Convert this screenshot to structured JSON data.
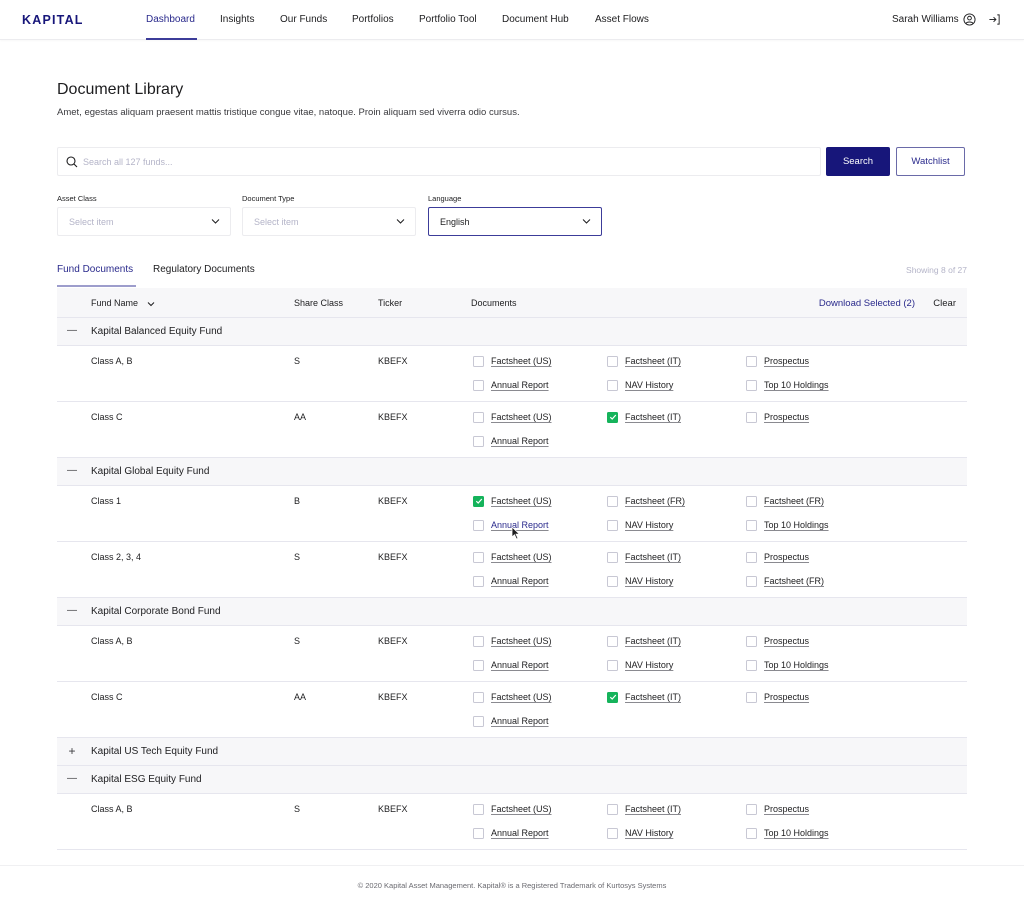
{
  "brand": {
    "logo": "KAPITAL",
    "accent": "#17167a",
    "check_color": "#15b35b"
  },
  "nav": {
    "items": [
      {
        "label": "Dashboard",
        "active": true
      },
      {
        "label": "Insights"
      },
      {
        "label": "Our Funds"
      },
      {
        "label": "Portfolios"
      },
      {
        "label": "Portfolio Tool"
      },
      {
        "label": "Document Hub"
      },
      {
        "label": "Asset Flows"
      }
    ],
    "user_name": "Sarah Williams",
    "user_icon": "user-circle-icon",
    "logout_icon": "logout-icon"
  },
  "page": {
    "title": "Document Library",
    "description": "Amet, egestas aliquam praesent mattis tristique congue vitae, natoque. Proin aliquam sed viverra odio cursus."
  },
  "search": {
    "placeholder": "Search all 127 funds...",
    "value": "",
    "search_label": "Search",
    "watchlist_label": "Watchlist"
  },
  "filters": [
    {
      "label": "Asset Class",
      "value": "Select item",
      "placeholder": true
    },
    {
      "label": "Document Type",
      "value": "Select item",
      "placeholder": true
    },
    {
      "label": "Language",
      "value": "English",
      "placeholder": false
    }
  ],
  "tabs": [
    {
      "label": "Fund Documents",
      "active": true
    },
    {
      "label": "Regulatory Documents"
    }
  ],
  "showing": "Showing 8 of 27",
  "table": {
    "headers": {
      "fund_name": "Fund Name",
      "share_class": "Share Class",
      "ticker": "Ticker",
      "documents": "Documents"
    },
    "download_selected": "Download Selected (2)",
    "clear": "Clear",
    "funds": [
      {
        "name": "Kapital Balanced Equity Fund",
        "expanded": true,
        "classes": [
          {
            "class": "Class A, B",
            "share": "S",
            "ticker": "KBEFX",
            "docs": [
              {
                "label": "Factsheet (US)",
                "checked": false
              },
              {
                "label": "Factsheet (IT)",
                "checked": false
              },
              {
                "label": "Prospectus",
                "checked": false
              },
              {
                "label": "Annual Report",
                "checked": false
              },
              {
                "label": "NAV History",
                "checked": false
              },
              {
                "label": "Top 10 Holdings",
                "checked": false
              }
            ]
          },
          {
            "class": "Class C",
            "share": "AA",
            "ticker": "KBEFX",
            "docs": [
              {
                "label": "Factsheet (US)",
                "checked": false
              },
              {
                "label": "Factsheet (IT)",
                "checked": true
              },
              {
                "label": "Prospectus",
                "checked": false
              },
              {
                "label": "Annual Report",
                "checked": false
              }
            ]
          }
        ]
      },
      {
        "name": "Kapital Global Equity Fund",
        "expanded": true,
        "classes": [
          {
            "class": "Class 1",
            "share": "B",
            "ticker": "KBEFX",
            "docs": [
              {
                "label": "Factsheet (US)",
                "checked": true
              },
              {
                "label": "Factsheet (FR)",
                "checked": false
              },
              {
                "label": "Factsheet (FR)",
                "checked": false
              },
              {
                "label": "Annual Report",
                "checked": false,
                "hover": true
              },
              {
                "label": "NAV History",
                "checked": false
              },
              {
                "label": "Top 10 Holdings",
                "checked": false
              }
            ]
          },
          {
            "class": "Class 2, 3, 4",
            "share": "S",
            "ticker": "KBEFX",
            "docs": [
              {
                "label": "Factsheet (US)",
                "checked": false
              },
              {
                "label": "Factsheet (IT)",
                "checked": false
              },
              {
                "label": "Prospectus",
                "checked": false
              },
              {
                "label": "Annual Report",
                "checked": false
              },
              {
                "label": "NAV History",
                "checked": false
              },
              {
                "label": "Factsheet (FR)",
                "checked": false
              }
            ]
          }
        ]
      },
      {
        "name": "Kapital Corporate Bond Fund",
        "expanded": true,
        "classes": [
          {
            "class": "Class A, B",
            "share": "S",
            "ticker": "KBEFX",
            "docs": [
              {
                "label": "Factsheet (US)",
                "checked": false
              },
              {
                "label": "Factsheet (IT)",
                "checked": false
              },
              {
                "label": "Prospectus",
                "checked": false
              },
              {
                "label": "Annual Report",
                "checked": false
              },
              {
                "label": "NAV History",
                "checked": false
              },
              {
                "label": "Top 10 Holdings",
                "checked": false
              }
            ]
          },
          {
            "class": "Class C",
            "share": "AA",
            "ticker": "KBEFX",
            "docs": [
              {
                "label": "Factsheet (US)",
                "checked": false
              },
              {
                "label": "Factsheet (IT)",
                "checked": true
              },
              {
                "label": "Prospectus",
                "checked": false
              },
              {
                "label": "Annual Report",
                "checked": false
              }
            ]
          }
        ]
      },
      {
        "name": "Kapital US Tech Equity Fund",
        "expanded": false,
        "classes": []
      },
      {
        "name": "Kapital ESG Equity Fund",
        "expanded": true,
        "classes": [
          {
            "class": "Class A, B",
            "share": "S",
            "ticker": "KBEFX",
            "docs": [
              {
                "label": "Factsheet (US)",
                "checked": false
              },
              {
                "label": "Factsheet (IT)",
                "checked": false
              },
              {
                "label": "Prospectus",
                "checked": false
              },
              {
                "label": "Annual Report",
                "checked": false
              },
              {
                "label": "NAV History",
                "checked": false
              },
              {
                "label": "Top 10 Holdings",
                "checked": false
              }
            ]
          }
        ]
      }
    ]
  },
  "footer": "© 2020 Kapital Asset Management. Kapital® is a Registered Trademark of Kurtosys Systems"
}
